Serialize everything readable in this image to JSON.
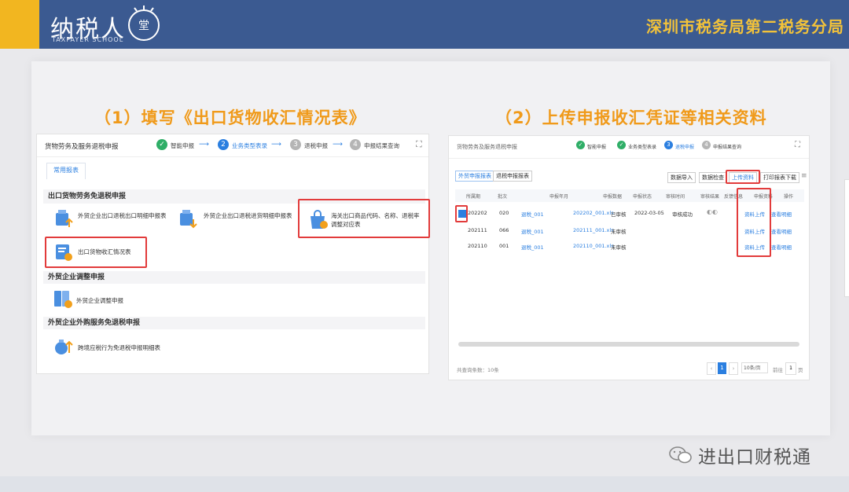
{
  "header": {
    "logo_text": "纳税人",
    "logo_sub": "TAXPAYER SCHOOL",
    "logo_seal_char": "学堂",
    "organization": "深圳市税务局第二税务分局",
    "colors": {
      "banner": "#3b5a91",
      "accent": "#f2b620",
      "org_text": "#f2c23a"
    }
  },
  "slide": {
    "step1_title": "（1）填写《出口货物收汇情况表》",
    "step2_title": "（2）上传申报收汇凭证等相关资料",
    "title_color": "#f09a1a"
  },
  "left_panel": {
    "title": "货物劳务及服务退税申报",
    "steps": [
      {
        "label": "智能申报",
        "state": "done",
        "num": "✓"
      },
      {
        "label": "业务类型表录",
        "state": "current",
        "num": "2"
      },
      {
        "label": "退税申报",
        "state": "todo",
        "num": "3"
      },
      {
        "label": "申报结果查询",
        "state": "todo",
        "num": "4"
      }
    ],
    "tab": "常用报表",
    "section1": "出口货物劳务免退税申报",
    "items1": [
      "外贸企业出口退税出口明细申报表",
      "外贸企业出口退税进货明细申报表",
      "海关出口商品代码、名称、退税率调整对应表",
      "出口货物收汇情况表"
    ],
    "section2": "外贸企业调整申报",
    "items2": [
      "外贸企业调整申报"
    ],
    "section3": "外贸企业外购服务免退税申报",
    "items3": [
      "跨境应税行为免退税申报明细表"
    ]
  },
  "right_panel": {
    "title": "货物劳务及服务退税申报",
    "steps": [
      {
        "label": "智能申报",
        "state": "done",
        "num": "✓"
      },
      {
        "label": "业务类型表录",
        "state": "done",
        "num": "✓"
      },
      {
        "label": "退税申报",
        "state": "current",
        "num": "3"
      },
      {
        "label": "申报结果查询",
        "state": "todo",
        "num": "4"
      }
    ],
    "tabs": [
      "外贸申报报表",
      "退税申报报表"
    ],
    "toolbar": [
      "数据导入",
      "数据检查",
      "上传资料",
      "打印报表下载"
    ],
    "columns": [
      "所属期",
      "批次",
      "申报年月",
      "申报数据",
      "申报状态",
      "审核时间",
      "审核结果",
      "反馈信息",
      "申报资料",
      "操作"
    ],
    "rows": [
      {
        "period": "202202",
        "batch": "020",
        "a": "退税_001",
        "b": "202202_001.xls",
        "state": "已审核",
        "date": "2022-03-05",
        "res": "审核成功",
        "upload": "资料上传",
        "op": "查看明细"
      },
      {
        "period": "202111",
        "batch": "066",
        "a": "退税_001",
        "b": "202111_001.xls",
        "state": "未审核",
        "date": "",
        "res": "",
        "upload": "资料上传",
        "op": "查看明细"
      },
      {
        "period": "202110",
        "batch": "001",
        "a": "退税_001",
        "b": "202110_001.xls",
        "state": "未审核",
        "date": "",
        "res": "",
        "upload": "资料上传",
        "op": "查看明细"
      }
    ],
    "footer_total": "共查询条数：10条",
    "page_num": "1",
    "page_size": "10条/页",
    "goto_label": "前往",
    "goto_value": "1",
    "goto_unit": "页"
  },
  "watermark": "进出口财税通"
}
